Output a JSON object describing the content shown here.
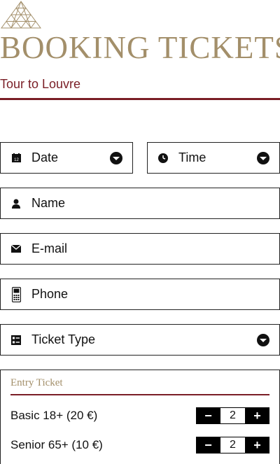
{
  "header": {
    "title": "BOOKING TICKETS",
    "subtitle": "Tour to Louvre"
  },
  "colors": {
    "brand_gold": "#a38f6a",
    "accent_maroon": "#7a1e26"
  },
  "form": {
    "date": {
      "label": "Date",
      "icon": "calendar-icon"
    },
    "time": {
      "label": "Time",
      "icon": "clock-icon"
    },
    "name": {
      "label": "Name",
      "icon": "user-icon"
    },
    "email": {
      "label": "E-mail",
      "icon": "envelope-icon"
    },
    "phone": {
      "label": "Phone",
      "icon": "phone-icon"
    },
    "ticket_type": {
      "label": "Ticket Type",
      "icon": "list-icon"
    }
  },
  "entry": {
    "title": "Entry Ticket",
    "tickets": [
      {
        "label": "Basic 18+ (20 €)",
        "quantity": "2",
        "minus": "−",
        "plus": "+"
      },
      {
        "label": "Senior 65+ (10 €)",
        "quantity": "2",
        "minus": "−",
        "plus": "+"
      }
    ]
  }
}
